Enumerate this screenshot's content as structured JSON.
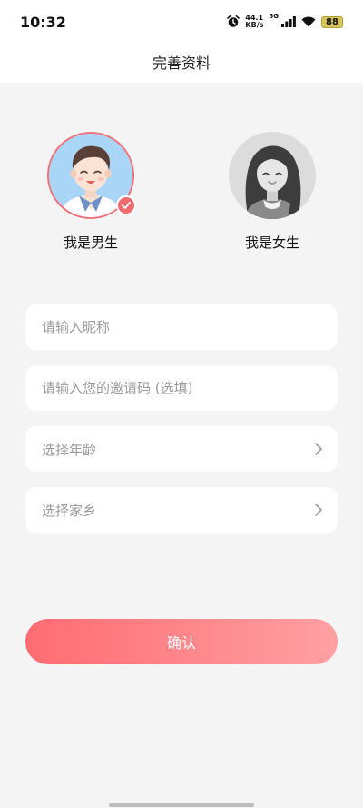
{
  "status_bar": {
    "time": "10:32",
    "speed_value": "44.1",
    "speed_unit": "KB/s",
    "network": "5G",
    "battery": "88"
  },
  "page": {
    "title": "完善资料"
  },
  "gender": {
    "male_label": "我是男生",
    "female_label": "我是女生",
    "selected": "male"
  },
  "form": {
    "nickname_placeholder": "请输入昵称",
    "invite_placeholder": "请输入您的邀请码 (选填)",
    "age_label": "选择年龄",
    "hometown_label": "选择家乡"
  },
  "actions": {
    "confirm_label": "确认"
  },
  "colors": {
    "accent": "#f06a6f",
    "gradient_start": "#fe6c72",
    "gradient_end": "#fea0a3"
  }
}
